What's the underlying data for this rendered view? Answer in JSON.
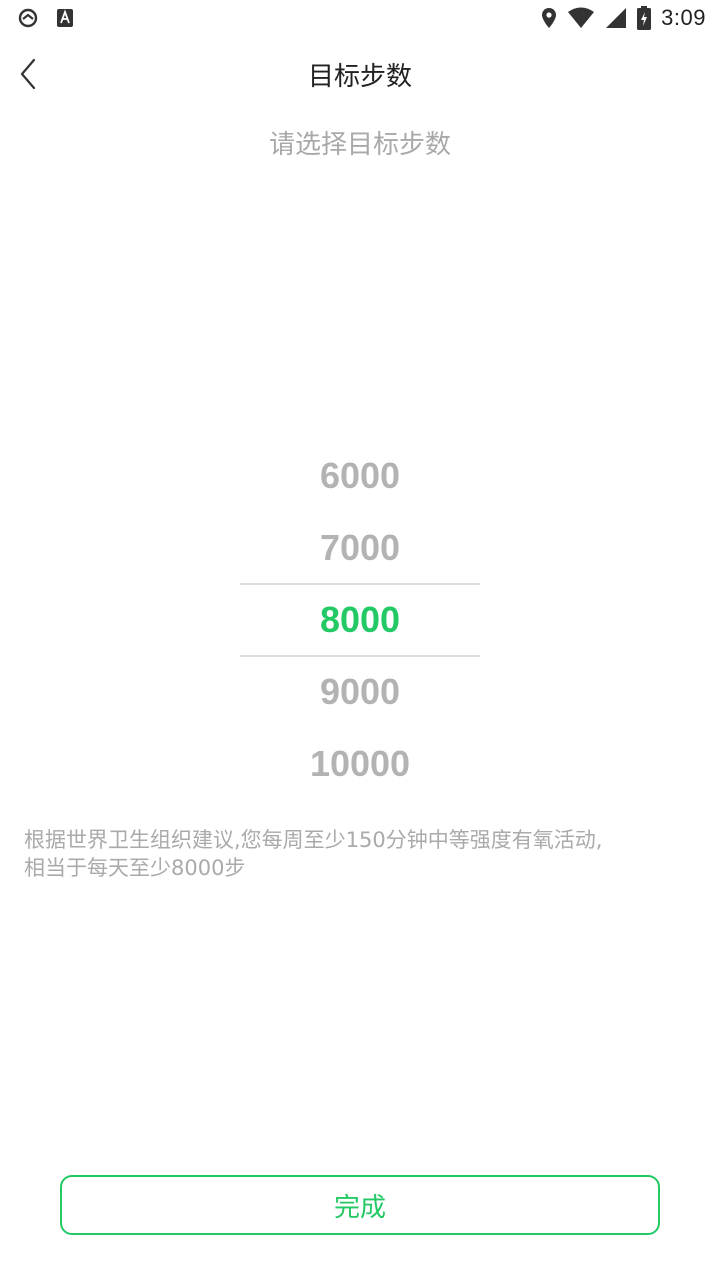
{
  "status_bar": {
    "time": "3:09",
    "left_icons": [
      "sync-icon",
      "keyboard-a-icon"
    ],
    "right_icons": [
      "location-icon",
      "wifi-icon",
      "signal-icon",
      "battery-charging-icon"
    ]
  },
  "header": {
    "title": "目标步数",
    "back_icon": "chevron-left-icon"
  },
  "subtitle": "请选择目标步数",
  "picker": {
    "options": [
      "6000",
      "7000",
      "8000",
      "9000",
      "10000"
    ],
    "selected_index": 2,
    "selected_value": "8000"
  },
  "note": {
    "line1": "根据世界卫生组织建议,您每周至少150分钟中等强度有氧活动,",
    "line2": "相当于每天至少8000步"
  },
  "done_button": {
    "label": "完成"
  },
  "colors": {
    "accent": "#23c965",
    "muted_text": "#a9a9a9",
    "picker_text": "#b3b3b3"
  }
}
